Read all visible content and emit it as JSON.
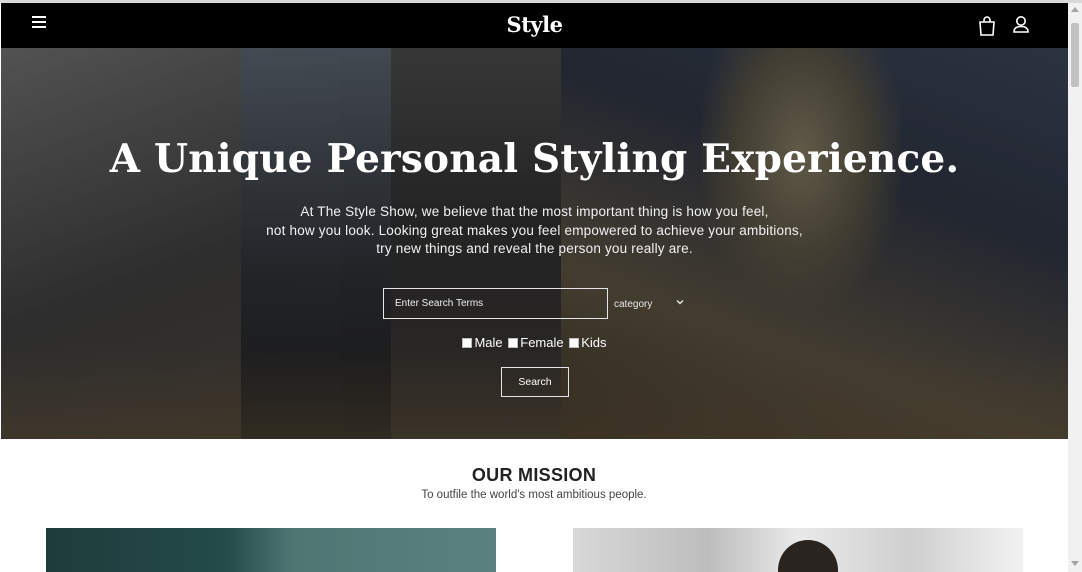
{
  "nav": {
    "brand": "Style",
    "menu_icon": "hamburger-menu-icon",
    "bag_icon": "shopping-bag-icon",
    "user_icon": "user-account-icon"
  },
  "hero": {
    "title": "A Unique Personal Styling Experience.",
    "text_lines": [
      "At The Style Show, we believe that the most important thing is how you feel,",
      "not how you look. Looking great makes you feel empowered to achieve your ambitions,",
      "try new things and reveal the person you really are."
    ],
    "search_placeholder": "Enter Search Terms",
    "category_label": "category",
    "category_icon": "chevron-down-icon",
    "checkboxes": [
      {
        "label": "Male",
        "checked": false
      },
      {
        "label": "Female",
        "checked": false
      },
      {
        "label": "Kids",
        "checked": false
      }
    ],
    "search_button": "Search"
  },
  "mission": {
    "title": "OUR MISSION",
    "subtitle": "To outfile the world's most ambitious people."
  },
  "colors": {
    "nav_background": "#000000",
    "hero_text": "#ffffff",
    "page_background": "#ffffff"
  }
}
